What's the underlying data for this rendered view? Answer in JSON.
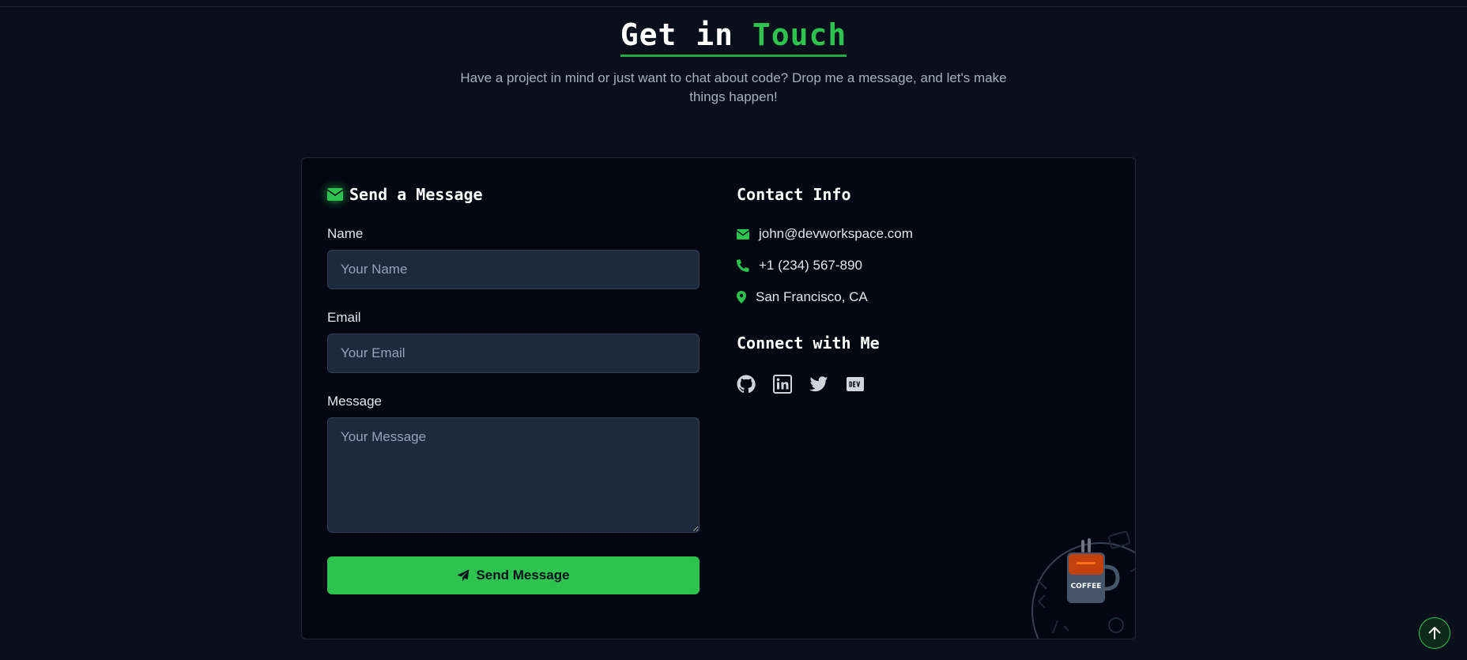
{
  "heading": {
    "title_part1": "Get in ",
    "title_accent": "Touch"
  },
  "subtitle": "Have a project in mind or just want to chat about code? Drop me a message, and let's make things happen!",
  "form": {
    "title": "Send a Message",
    "name_label": "Name",
    "name_placeholder": "Your Name",
    "email_label": "Email",
    "email_placeholder": "Your Email",
    "message_label": "Message",
    "message_placeholder": "Your Message",
    "submit_label": "Send Message"
  },
  "contact": {
    "title": "Contact Info",
    "email": "john@devworkspace.com",
    "phone": "+1 (234) 567-890",
    "location": "San Francisco, CA"
  },
  "connect": {
    "title": "Connect with Me",
    "links": [
      "github-icon",
      "linkedin-icon",
      "twitter-icon",
      "dev-icon"
    ]
  },
  "illustration": {
    "mug_text": "COFFEE"
  },
  "icons": {
    "envelope": "envelope-icon",
    "phone": "phone-icon",
    "location": "map-pin-icon",
    "send": "paper-plane-icon",
    "scroll_top": "arrow-up-icon"
  },
  "colors": {
    "accent": "#2ec24e",
    "background": "#0a0f1c",
    "card": "#030712",
    "input": "#1e293b"
  }
}
